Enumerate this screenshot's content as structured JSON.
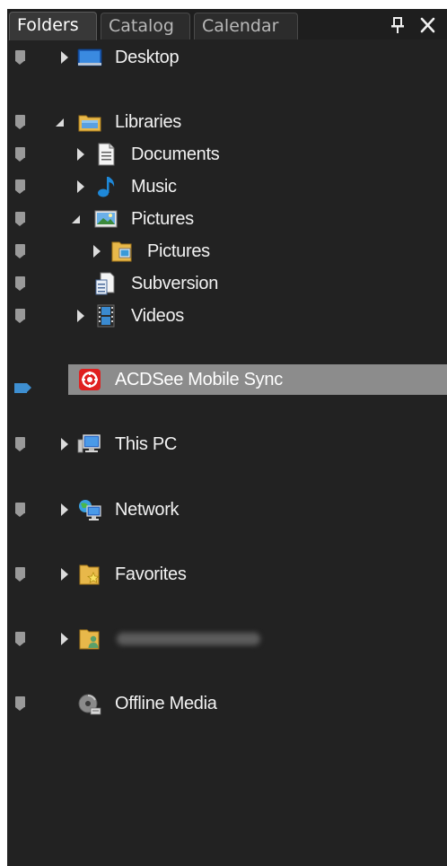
{
  "tabs": [
    {
      "label": "Folders",
      "active": true
    },
    {
      "label": "Catalog",
      "active": false
    },
    {
      "label": "Calendar",
      "active": false
    }
  ],
  "window_buttons": {
    "pin": "p",
    "close": "✕"
  },
  "tree": {
    "desktop": "Desktop",
    "libraries": "Libraries",
    "documents": "Documents",
    "music": "Music",
    "pictures_lib": "Pictures",
    "pictures_folder": "Pictures",
    "subversion": "Subversion",
    "videos": "Videos",
    "acdsee_sync": "ACDSee Mobile Sync",
    "this_pc": "This PC",
    "network": "Network",
    "favorites": "Favorites",
    "user_folder": "",
    "offline_media": "Offline Media"
  },
  "colors": {
    "panel_bg": "#222222",
    "selection": "#8c8c8c",
    "selection_tag": "#3e8fd1",
    "tag_gray": "#9a9a9a",
    "acdsee_red": "#e02020"
  }
}
